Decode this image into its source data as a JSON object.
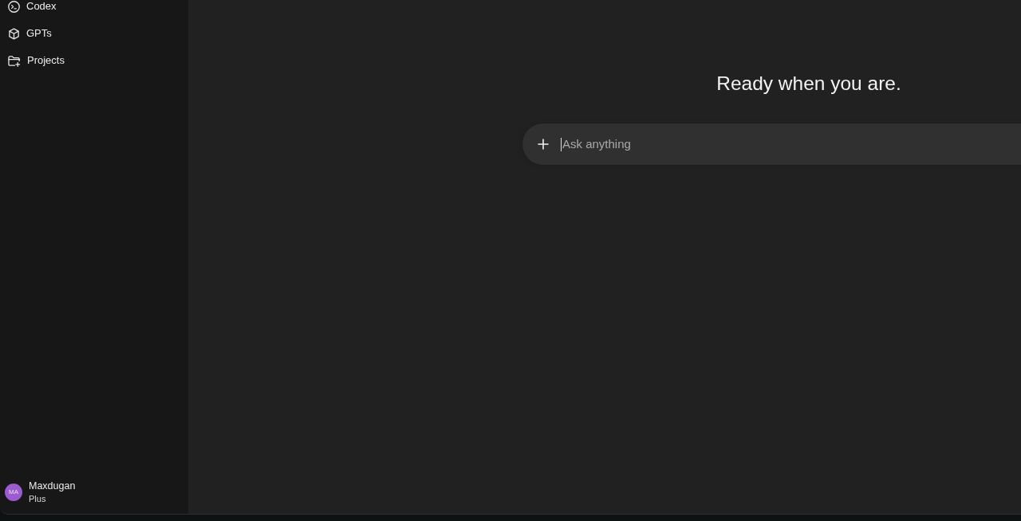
{
  "sidebar": {
    "items": [
      {
        "label": "Codex",
        "kind": "codex"
      },
      {
        "label": "GPTs",
        "kind": "gpts"
      },
      {
        "label": "Projects",
        "kind": "projects"
      }
    ],
    "account": {
      "initials": "MA",
      "name": "Maxdugan",
      "plan": "Plus"
    }
  },
  "main": {
    "heading": "Ready when you are.",
    "composer": {
      "placeholder": "Ask anything"
    }
  }
}
